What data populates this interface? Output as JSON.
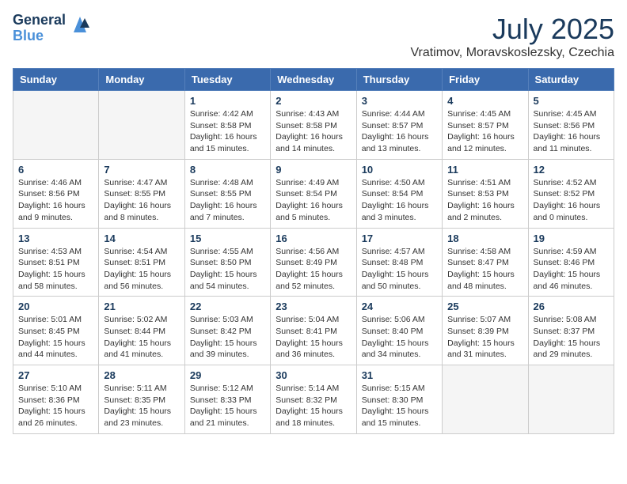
{
  "header": {
    "logo": {
      "general": "General",
      "blue": "Blue"
    },
    "title": "July 2025",
    "location": "Vratimov, Moravskoslezsky, Czechia"
  },
  "days_of_week": [
    "Sunday",
    "Monday",
    "Tuesday",
    "Wednesday",
    "Thursday",
    "Friday",
    "Saturday"
  ],
  "weeks": [
    [
      {
        "day": "",
        "info": ""
      },
      {
        "day": "",
        "info": ""
      },
      {
        "day": "1",
        "info": "Sunrise: 4:42 AM\nSunset: 8:58 PM\nDaylight: 16 hours and 15 minutes."
      },
      {
        "day": "2",
        "info": "Sunrise: 4:43 AM\nSunset: 8:58 PM\nDaylight: 16 hours and 14 minutes."
      },
      {
        "day": "3",
        "info": "Sunrise: 4:44 AM\nSunset: 8:57 PM\nDaylight: 16 hours and 13 minutes."
      },
      {
        "day": "4",
        "info": "Sunrise: 4:45 AM\nSunset: 8:57 PM\nDaylight: 16 hours and 12 minutes."
      },
      {
        "day": "5",
        "info": "Sunrise: 4:45 AM\nSunset: 8:56 PM\nDaylight: 16 hours and 11 minutes."
      }
    ],
    [
      {
        "day": "6",
        "info": "Sunrise: 4:46 AM\nSunset: 8:56 PM\nDaylight: 16 hours and 9 minutes."
      },
      {
        "day": "7",
        "info": "Sunrise: 4:47 AM\nSunset: 8:55 PM\nDaylight: 16 hours and 8 minutes."
      },
      {
        "day": "8",
        "info": "Sunrise: 4:48 AM\nSunset: 8:55 PM\nDaylight: 16 hours and 7 minutes."
      },
      {
        "day": "9",
        "info": "Sunrise: 4:49 AM\nSunset: 8:54 PM\nDaylight: 16 hours and 5 minutes."
      },
      {
        "day": "10",
        "info": "Sunrise: 4:50 AM\nSunset: 8:54 PM\nDaylight: 16 hours and 3 minutes."
      },
      {
        "day": "11",
        "info": "Sunrise: 4:51 AM\nSunset: 8:53 PM\nDaylight: 16 hours and 2 minutes."
      },
      {
        "day": "12",
        "info": "Sunrise: 4:52 AM\nSunset: 8:52 PM\nDaylight: 16 hours and 0 minutes."
      }
    ],
    [
      {
        "day": "13",
        "info": "Sunrise: 4:53 AM\nSunset: 8:51 PM\nDaylight: 15 hours and 58 minutes."
      },
      {
        "day": "14",
        "info": "Sunrise: 4:54 AM\nSunset: 8:51 PM\nDaylight: 15 hours and 56 minutes."
      },
      {
        "day": "15",
        "info": "Sunrise: 4:55 AM\nSunset: 8:50 PM\nDaylight: 15 hours and 54 minutes."
      },
      {
        "day": "16",
        "info": "Sunrise: 4:56 AM\nSunset: 8:49 PM\nDaylight: 15 hours and 52 minutes."
      },
      {
        "day": "17",
        "info": "Sunrise: 4:57 AM\nSunset: 8:48 PM\nDaylight: 15 hours and 50 minutes."
      },
      {
        "day": "18",
        "info": "Sunrise: 4:58 AM\nSunset: 8:47 PM\nDaylight: 15 hours and 48 minutes."
      },
      {
        "day": "19",
        "info": "Sunrise: 4:59 AM\nSunset: 8:46 PM\nDaylight: 15 hours and 46 minutes."
      }
    ],
    [
      {
        "day": "20",
        "info": "Sunrise: 5:01 AM\nSunset: 8:45 PM\nDaylight: 15 hours and 44 minutes."
      },
      {
        "day": "21",
        "info": "Sunrise: 5:02 AM\nSunset: 8:44 PM\nDaylight: 15 hours and 41 minutes."
      },
      {
        "day": "22",
        "info": "Sunrise: 5:03 AM\nSunset: 8:42 PM\nDaylight: 15 hours and 39 minutes."
      },
      {
        "day": "23",
        "info": "Sunrise: 5:04 AM\nSunset: 8:41 PM\nDaylight: 15 hours and 36 minutes."
      },
      {
        "day": "24",
        "info": "Sunrise: 5:06 AM\nSunset: 8:40 PM\nDaylight: 15 hours and 34 minutes."
      },
      {
        "day": "25",
        "info": "Sunrise: 5:07 AM\nSunset: 8:39 PM\nDaylight: 15 hours and 31 minutes."
      },
      {
        "day": "26",
        "info": "Sunrise: 5:08 AM\nSunset: 8:37 PM\nDaylight: 15 hours and 29 minutes."
      }
    ],
    [
      {
        "day": "27",
        "info": "Sunrise: 5:10 AM\nSunset: 8:36 PM\nDaylight: 15 hours and 26 minutes."
      },
      {
        "day": "28",
        "info": "Sunrise: 5:11 AM\nSunset: 8:35 PM\nDaylight: 15 hours and 23 minutes."
      },
      {
        "day": "29",
        "info": "Sunrise: 5:12 AM\nSunset: 8:33 PM\nDaylight: 15 hours and 21 minutes."
      },
      {
        "day": "30",
        "info": "Sunrise: 5:14 AM\nSunset: 8:32 PM\nDaylight: 15 hours and 18 minutes."
      },
      {
        "day": "31",
        "info": "Sunrise: 5:15 AM\nSunset: 8:30 PM\nDaylight: 15 hours and 15 minutes."
      },
      {
        "day": "",
        "info": ""
      },
      {
        "day": "",
        "info": ""
      }
    ]
  ]
}
